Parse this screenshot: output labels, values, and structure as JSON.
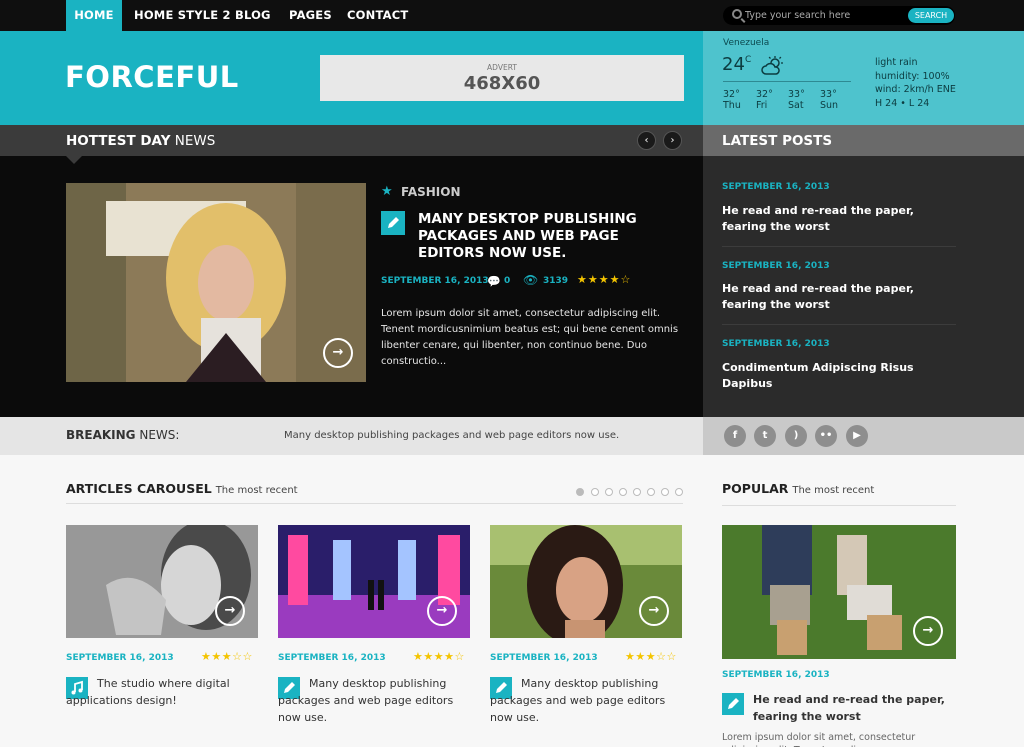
{
  "nav": {
    "items": [
      "HOME",
      "HOME STYLE 2",
      "BLOG",
      "PAGES",
      "CONTACT"
    ],
    "active_index": 0
  },
  "search": {
    "placeholder": "Type your search here",
    "button_label": "SEARCH"
  },
  "header": {
    "logo": "FORCEFUL",
    "advert_label": "ADVERT",
    "advert_size": "468X60"
  },
  "weather": {
    "city": "Venezuela",
    "temp": "24",
    "unit": "C",
    "forecast": [
      {
        "temp": "32",
        "day": "Thu"
      },
      {
        "temp": "32",
        "day": "Fri"
      },
      {
        "temp": "33",
        "day": "Sat"
      },
      {
        "temp": "33",
        "day": "Sun"
      }
    ],
    "condition": "light rain",
    "humidity": "humidity: 100%",
    "wind": "wind: 2km/h ENE",
    "hilo": "H 24 • L 24"
  },
  "hottest": {
    "title_bold": "HOTTEST DAY",
    "title_rest": " NEWS",
    "category": "FASHION",
    "headline": "MANY DESKTOP PUBLISHING PACKAGES AND WEB PAGE EDITORS NOW USE.",
    "date": "SEPTEMBER 16, 2013",
    "comments": "0",
    "views": "3139",
    "rating": 4,
    "excerpt": "Lorem ipsum dolor sit amet, consectetur adipiscing elit. Tenent mordicusnimium beatus est; qui bene cenent omnis libenter cenare, qui libenter, non continuo bene. Duo constructio..."
  },
  "latest": {
    "title": "LATEST POSTS",
    "posts": [
      {
        "date": "SEPTEMBER 16, 2013",
        "title": "He read and re-read the paper, fearing the worst"
      },
      {
        "date": "SEPTEMBER 16, 2013",
        "title": "He read and re-read the paper, fearing the worst"
      },
      {
        "date": "SEPTEMBER 16, 2013",
        "title": "Condimentum Adipiscing Risus Dapibus"
      }
    ]
  },
  "breaking": {
    "title_bold": "BREAKING",
    "title_rest": " NEWS:",
    "text": "Many desktop publishing packages and web page editors now use."
  },
  "social": [
    "f",
    "t",
    "rss",
    "flickr",
    "yt"
  ],
  "carousel": {
    "title": "ARTICLES CAROUSEL",
    "subtitle": "The most recent",
    "dots": 8,
    "active_dot": 0,
    "cards": [
      {
        "date": "SEPTEMBER 16, 2013",
        "rating": 3,
        "icon": "music-icon",
        "text": "The studio where digital applications design!"
      },
      {
        "date": "SEPTEMBER 16, 2013",
        "rating": 4,
        "icon": "pencil-icon",
        "text": "Many desktop publishing packages and web page editors now use."
      },
      {
        "date": "SEPTEMBER 16, 2013",
        "rating": 3,
        "icon": "pencil-icon",
        "text": "Many desktop publishing packages and web page editors now use."
      }
    ]
  },
  "popular": {
    "title": "POPULAR",
    "subtitle": "The most recent",
    "date": "SEPTEMBER 16, 2013",
    "headline": "He read and re-read the paper, fearing the worst",
    "excerpt": "Lorem ipsum dolor sit amet, consectetur adipiscing elit. Tenent mordicus"
  },
  "colors": {
    "accent": "#1ab3c2",
    "star": "#f4c400",
    "dark": "#0b0b0b"
  }
}
